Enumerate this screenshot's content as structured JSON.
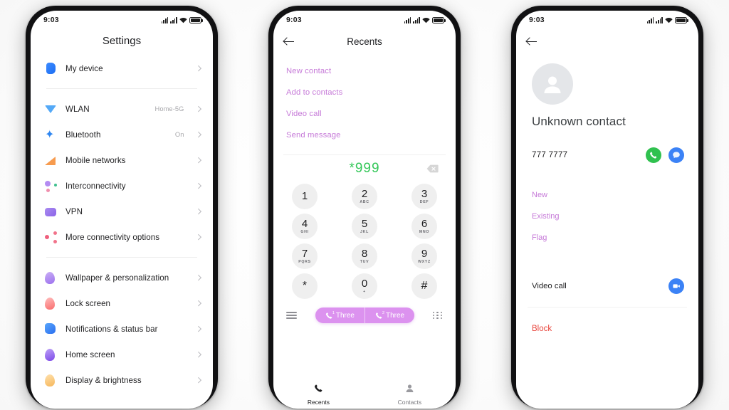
{
  "theme": {
    "accent_purple": "#c67ad8",
    "sim_pill": "#dc92ef",
    "dial_green": "#34c759",
    "call_green": "#30c14f",
    "msg_blue": "#3b82f6",
    "block_red": "#e8453c"
  },
  "status_bar": {
    "time": "9:03",
    "icons": [
      "signal-bars-sim1",
      "signal-bars-sim2",
      "wifi-icon",
      "battery-icon"
    ]
  },
  "settings_screen": {
    "title": "Settings",
    "groups": [
      {
        "rows": [
          {
            "icon": "device-icon",
            "label": "My device",
            "value": "",
            "chevron": true
          }
        ]
      },
      {
        "rows": [
          {
            "icon": "wlan-icon",
            "label": "WLAN",
            "value": "Home-5G",
            "chevron": true
          },
          {
            "icon": "bluetooth-icon",
            "label": "Bluetooth",
            "value": "On",
            "chevron": true
          },
          {
            "icon": "mobile-networks-icon",
            "label": "Mobile networks",
            "value": "",
            "chevron": true
          },
          {
            "icon": "interconnectivity-icon",
            "label": "Interconnectivity",
            "value": "",
            "chevron": true
          },
          {
            "icon": "vpn-icon",
            "label": "VPN",
            "value": "",
            "chevron": true
          },
          {
            "icon": "more-connectivity-icon",
            "label": "More connectivity options",
            "value": "",
            "chevron": true
          }
        ]
      },
      {
        "rows": [
          {
            "icon": "wallpaper-icon",
            "label": "Wallpaper & personalization",
            "value": "",
            "chevron": true
          },
          {
            "icon": "lock-screen-icon",
            "label": "Lock screen",
            "value": "",
            "chevron": true
          },
          {
            "icon": "notifications-icon",
            "label": "Notifications & status bar",
            "value": "",
            "chevron": true
          },
          {
            "icon": "home-screen-icon",
            "label": "Home screen",
            "value": "",
            "chevron": true
          },
          {
            "icon": "display-brightness-icon",
            "label": "Display & brightness",
            "value": "",
            "chevron": true
          }
        ]
      }
    ]
  },
  "dialer_screen": {
    "title": "Recents",
    "back_icon": "back-arrow-icon",
    "menu_links": [
      "New contact",
      "Add to contacts",
      "Video call",
      "Send message"
    ],
    "dialed_number": "*999",
    "backspace_icon": "backspace-icon",
    "keys": [
      {
        "digit": "1",
        "letters": ""
      },
      {
        "digit": "2",
        "letters": "ABC"
      },
      {
        "digit": "3",
        "letters": "DEF"
      },
      {
        "digit": "4",
        "letters": "GHI"
      },
      {
        "digit": "5",
        "letters": "JKL"
      },
      {
        "digit": "6",
        "letters": "MNO"
      },
      {
        "digit": "7",
        "letters": "PQRS"
      },
      {
        "digit": "8",
        "letters": "TUV"
      },
      {
        "digit": "9",
        "letters": "WXYZ"
      },
      {
        "digit": "*",
        "letters": ""
      },
      {
        "digit": "0",
        "letters": "+"
      },
      {
        "digit": "#",
        "letters": ""
      }
    ],
    "call_bar": {
      "menu_icon": "hamburger-menu-icon",
      "sim1_label": "Three",
      "sim1_sup": "1",
      "sim2_label": "Three",
      "sim2_sup": "2",
      "keypad_icon": "keypad-grid-icon"
    },
    "bottom_nav": [
      {
        "icon": "phone-icon",
        "label": "Recents"
      },
      {
        "icon": "contacts-icon",
        "label": "Contacts"
      }
    ]
  },
  "contact_screen": {
    "back_icon": "back-arrow-icon",
    "avatar_icon": "person-avatar-icon",
    "name": "Unknown contact",
    "number": "777 7777",
    "call_icon": "phone-call-icon",
    "message_icon": "message-bubble-icon",
    "links": [
      "New",
      "Existing",
      "Flag"
    ],
    "video_call_label": "Video call",
    "video_icon": "video-camera-icon",
    "block_label": "Block"
  }
}
